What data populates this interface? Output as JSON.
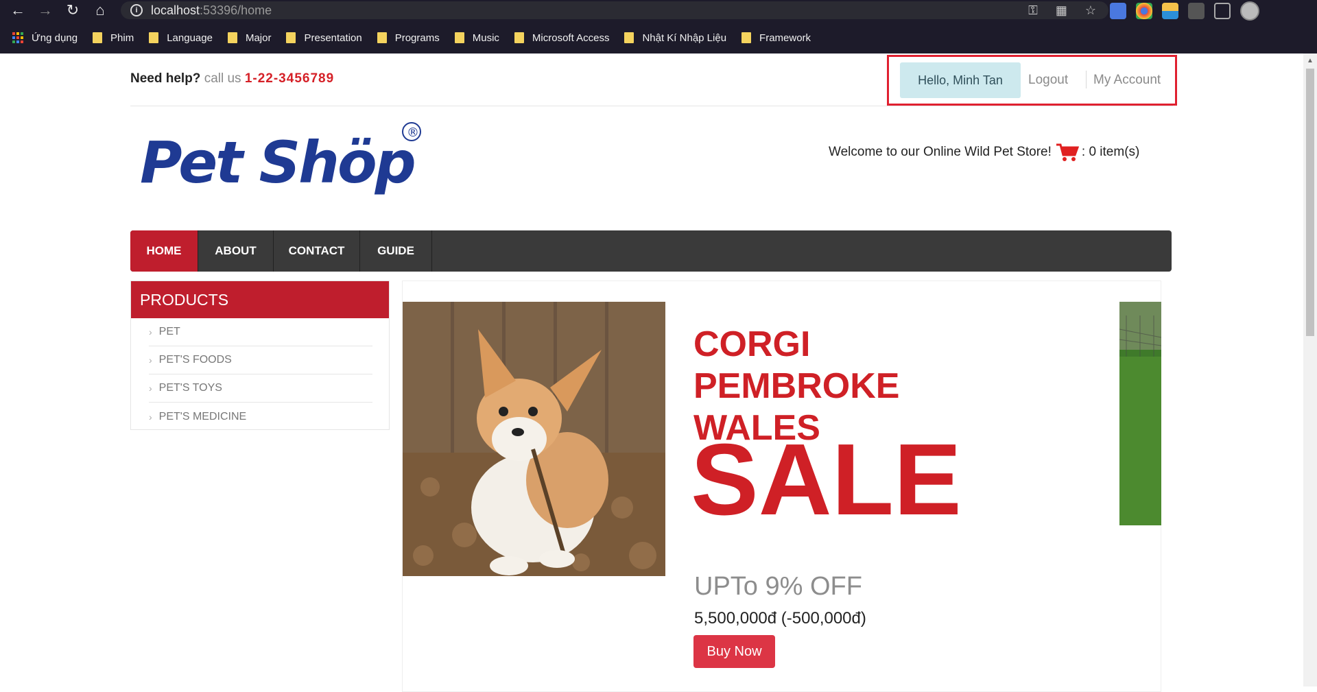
{
  "browser": {
    "url_host": "localhost",
    "url_rest": ":53396/home",
    "bookmarks": [
      {
        "label": "Ứng dụng",
        "type": "apps"
      },
      {
        "label": "Phim",
        "type": "folder"
      },
      {
        "label": "Language",
        "type": "folder"
      },
      {
        "label": "Major",
        "type": "folder"
      },
      {
        "label": "Presentation",
        "type": "folder"
      },
      {
        "label": "Programs",
        "type": "folder"
      },
      {
        "label": "Music",
        "type": "folder"
      },
      {
        "label": "Microsoft Access",
        "type": "folder"
      },
      {
        "label": "Nhật Kí Nhập Liệu",
        "type": "folder"
      },
      {
        "label": "Framework",
        "type": "folder"
      }
    ]
  },
  "header": {
    "need_help": "Need help?",
    "call_us": "call us",
    "phone": "1-22-3456789",
    "hello": "Hello, Minh Tan",
    "logout": "Logout",
    "my_account": "My Account"
  },
  "logo": {
    "text": "Pet Shöp",
    "mark": "®"
  },
  "cart": {
    "welcome": "Welcome to our Online Wild Pet Store!",
    "items": ": 0 item(s)"
  },
  "nav": {
    "items": [
      {
        "label": "HOME",
        "active": true
      },
      {
        "label": "ABOUT",
        "active": false
      },
      {
        "label": "CONTACT",
        "active": false
      },
      {
        "label": "GUIDE",
        "active": false
      }
    ]
  },
  "products": {
    "title": "PRODUCTS",
    "items": [
      "PET",
      "PET'S FOODS",
      "PET'S TOYS",
      "PET'S MEDICINE"
    ]
  },
  "banner": {
    "line1": "CORGI",
    "line2": "PEMBROKE",
    "line3": "WALES",
    "sale": "SALE",
    "discount": "UPTo 9% OFF",
    "price": "5,500,000đ (-500,000đ)",
    "buy": "Buy Now"
  },
  "colors": {
    "brand_red": "#bf1e2d",
    "logo_blue": "#1f3a93",
    "nav_dark": "#3a3a3a"
  }
}
